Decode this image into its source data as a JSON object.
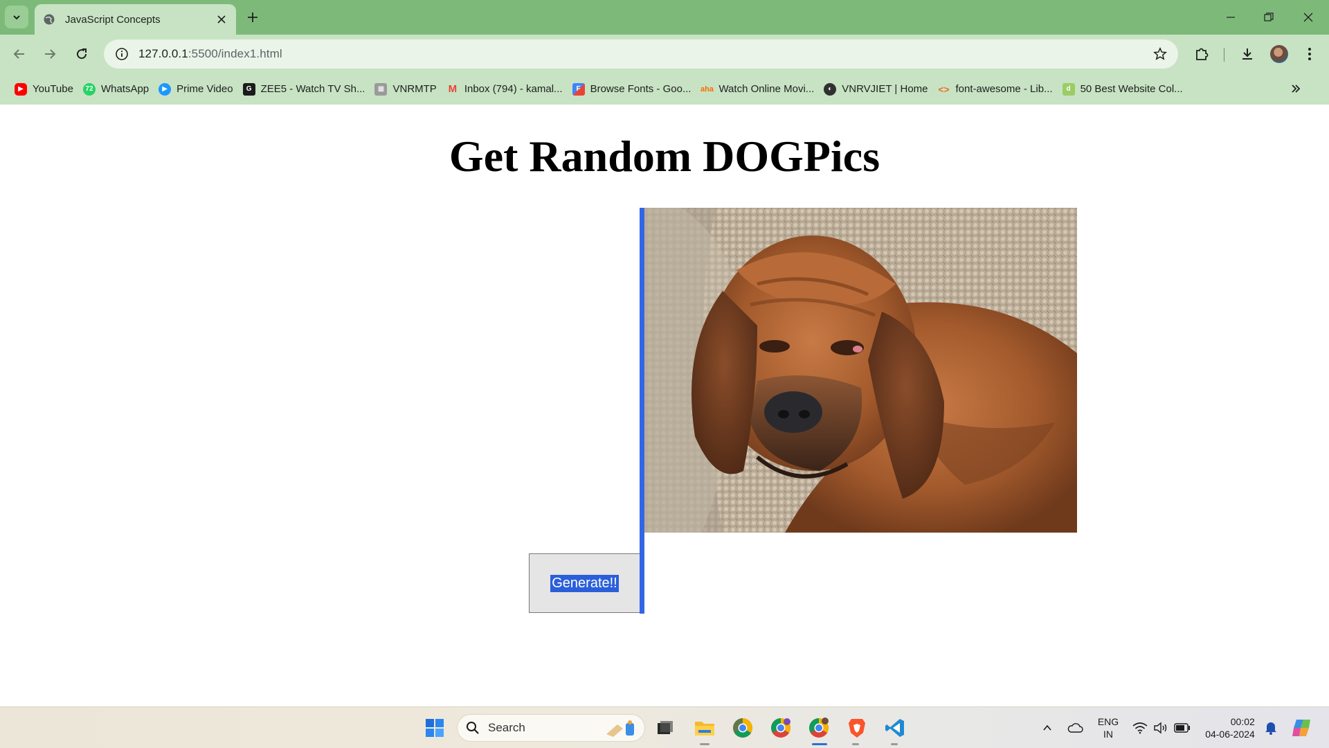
{
  "browser": {
    "tab_title": "JavaScript Concepts",
    "url_host": "127.0.0.1",
    "url_path": ":5500/index1.html",
    "bookmarks": [
      {
        "label": "YouTube",
        "icon": "youtube-icon",
        "color": "#ff0000"
      },
      {
        "label": "WhatsApp",
        "icon": "whatsapp-icon",
        "color": "#25d366"
      },
      {
        "label": "Prime Video",
        "icon": "prime-video-icon",
        "color": "#1a98ff"
      },
      {
        "label": "ZEE5 - Watch TV Sh...",
        "icon": "zee5-icon",
        "color": "#1b1b1b"
      },
      {
        "label": "VNRMTP",
        "icon": "vnrmtp-icon",
        "color": "#8a8a8a"
      },
      {
        "label": "Inbox (794) - kamal...",
        "icon": "gmail-icon",
        "color": "#ea4335"
      },
      {
        "label": "Browse Fonts - Goo...",
        "icon": "google-fonts-icon",
        "color": "#4285f4"
      },
      {
        "label": "Watch Online Movi...",
        "icon": "aha-icon",
        "color": "#ff6a00"
      },
      {
        "label": "VNRVJIET | Home",
        "icon": "globe-icon",
        "color": "#303030"
      },
      {
        "label": "font-awesome - Lib...",
        "icon": "code-icon",
        "color": "#e8702a"
      },
      {
        "label": "50 Best Website Col...",
        "icon": "d-icon",
        "color": "#7cb342"
      }
    ]
  },
  "page": {
    "heading": "Get Random DOGPics",
    "image_alt": "Random dog picture",
    "button_label": "Generate!!"
  },
  "taskbar": {
    "search_label": "Search",
    "language_line1": "ENG",
    "language_line2": "IN",
    "time": "00:02",
    "date": "04-06-2024"
  },
  "colors": {
    "tab_strip": "#7dba7a",
    "toolbar": "#c7e3c3",
    "selection": "#2b5fd9"
  }
}
